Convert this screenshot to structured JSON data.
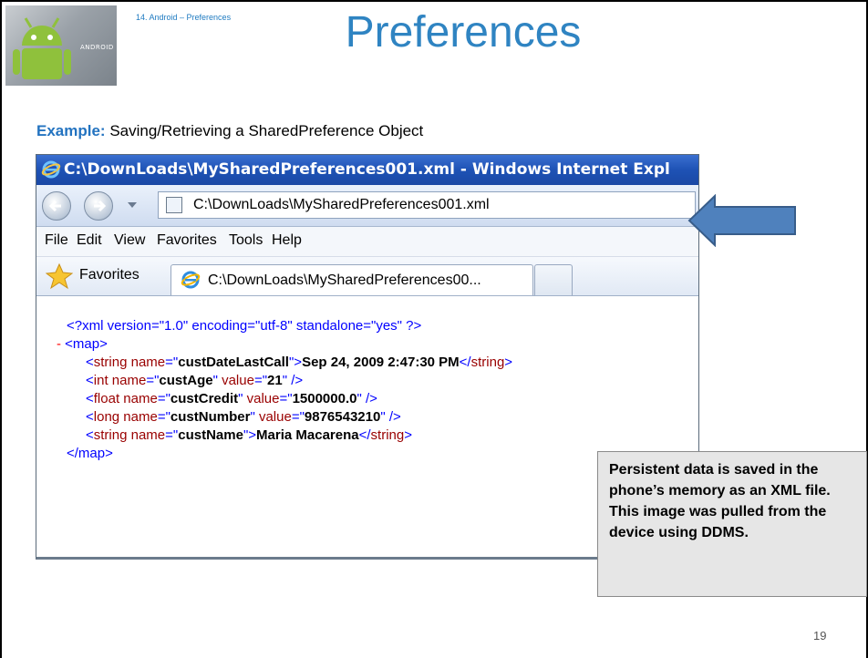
{
  "slide": {
    "breadcrumb": "14. Android – Preferences",
    "title": "Preferences",
    "example_label": "Example:",
    "example_text": " Saving/Retrieving a SharedPreference Object",
    "logo_text": "ANDROID",
    "page_number": "19",
    "note": "Persistent data is saved in the phone’s memory as an XML file. This image was pulled from the device using DDMS.",
    "arrow_color": "#4f81bd"
  },
  "browser": {
    "window_title": "C:\\DownLoads\\MySharedPreferences001.xml - Windows Internet Expl",
    "address_url": "C:\\DownLoads\\MySharedPreferences001.xml",
    "menu": [
      "File",
      "Edit",
      "View",
      "Favorites",
      "Tools",
      "Help"
    ],
    "favorites_label": "Favorites",
    "tab_label": "C:\\DownLoads\\MySharedPreferences00...",
    "xml": {
      "declaration": "<?xml version=\"1.0\" encoding=\"utf-8\" standalone=\"yes\" ?>",
      "collapse": "-",
      "map_open": "<map>",
      "map_close": "</map>",
      "rows": [
        {
          "tag": "string",
          "name": "custDateLastCall",
          "text": "Sep 24, 2009 2:47:30 PM"
        },
        {
          "tag": "int",
          "name": "custAge",
          "value": "21"
        },
        {
          "tag": "float",
          "name": "custCredit",
          "value": "1500000.0"
        },
        {
          "tag": "long",
          "name": "custNumber",
          "value": "9876543210"
        },
        {
          "tag": "string",
          "name": "custName",
          "text": "Maria Macarena"
        }
      ]
    }
  }
}
